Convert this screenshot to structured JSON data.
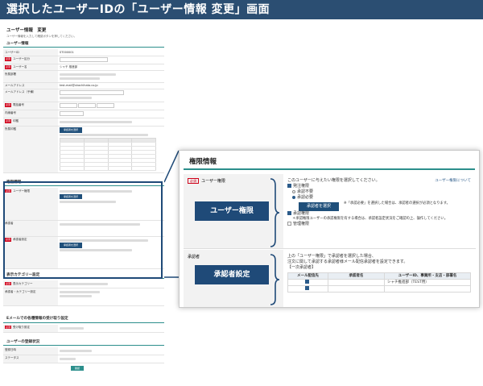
{
  "banner": {
    "title": "選択したユーザーIDの「ユーザー情報 変更」画面"
  },
  "page": {
    "title": "ユーザー情報　変更",
    "note": "ユーザー情報を入力して確認ボタンを押してください。",
    "section_user": "ユーザー情報",
    "fields": [
      {
        "label": "ユーザーID",
        "value": "ST000001",
        "req": false
      },
      {
        "label": "ユーザー区分",
        "value": "管理ユーザー",
        "req": true
      },
      {
        "label": "ユーザー名",
        "value": "シャチ 推進部",
        "req": true
      },
      {
        "label": "所属部署",
        "value": "",
        "req": false
      },
      {
        "label": "メールアドレス",
        "value": "test-mail@shachihata.co.jp",
        "req": false
      },
      {
        "label": "メールアドレス（予備）",
        "value": "",
        "req": false
      },
      {
        "label": "電話番号",
        "value": "",
        "req": true
      },
      {
        "label": "内線番号",
        "value": "",
        "req": false
      },
      {
        "label": "印鑑",
        "value": "",
        "req": true
      },
      {
        "label": "所属印鑑",
        "value": "",
        "req": false
      }
    ],
    "section_perm": "権限情報",
    "perm_rows": [
      {
        "label": "ユーザー権限",
        "req": true
      },
      {
        "label": "承認者",
        "req": false
      },
      {
        "label": "承認者設定",
        "req": true
      }
    ],
    "section_cat": "表示カテゴリー設定",
    "cat_rows": [
      {
        "label": "表示カテゴリー",
        "req": true
      },
      {
        "label": "承認者・カテゴリー設定",
        "req": false
      }
    ],
    "section_mail": "Eメールでの各種情報の受け取り設定",
    "mail_rows": [
      {
        "label": "受け取り設定",
        "req": true
      }
    ],
    "section_reg": "ユーザーの登録状況",
    "reg_rows": [
      {
        "label": "登録日時",
        "req": false
      },
      {
        "label": "ステータス",
        "req": false
      }
    ],
    "button_select": "承認者を選択",
    "button_confirm": "確認"
  },
  "panel": {
    "title": "権限情報",
    "row_a": {
      "label": "ユーザー権限",
      "required": "必須",
      "tag": "ユーザー権限",
      "intro": "このユーザーに与えたい権限を選択してください。",
      "help_link": "ユーザー権限について",
      "opt_1": "発注権限",
      "radio_1": "承認不要",
      "radio_2": "承認必要",
      "select_button": "承認者を選択",
      "select_note": "「承認必要」を選択した場合は、承認者の選択が必須となります。",
      "opt_2": "承認権限",
      "opt_2_note": "承認権限ユーザーの承認権限を有する場合は、承認者設定状況をご確認の上、操作してください。",
      "opt_3": "管理権限"
    },
    "row_b": {
      "label": "承認者",
      "tag": "承認者設定",
      "intro_1": "上の「ユーザー権限」で承認者を選択した場合、",
      "intro_2": "注文に関して承認する承認者様メール配信承認者を設定できます。",
      "list_label": "【一次承認者】",
      "col_1": "メール配信先",
      "col_2": "承認者名",
      "col_3": "ユーザーID、事業所・支店・部署名",
      "approver_name": "シャチ推進部（TEST用）"
    }
  }
}
